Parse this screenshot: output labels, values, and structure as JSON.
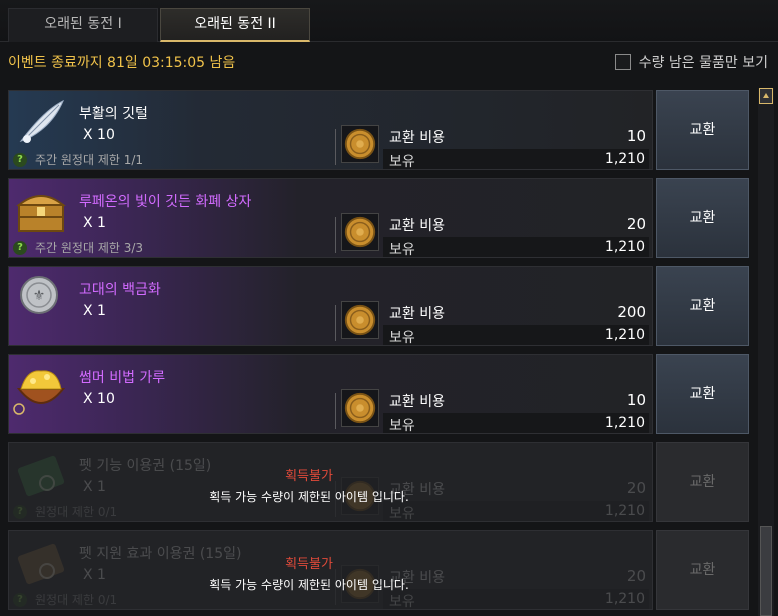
{
  "tabs": [
    {
      "label": "오래된 동전 I"
    },
    {
      "label": "오래된 동전 II"
    }
  ],
  "event_text": "이벤트 종료까지 81일 03:15:05 남음",
  "filter": {
    "label": "수량 남은 물품만 보기",
    "checked": false
  },
  "items": [
    {
      "name": "부활의 깃털",
      "qty": "X 10",
      "limit": "주간 원정대 제한 1/1",
      "cost_label": "교환 비용",
      "cost": "10",
      "own_label": "보유",
      "own": "1,210",
      "button": "교환",
      "icon": "feather-icon"
    },
    {
      "name": "루페온의 빛이 깃든 화폐 상자",
      "qty": "X 1",
      "limit": "주간 원정대 제한 3/3",
      "cost_label": "교환 비용",
      "cost": "20",
      "own_label": "보유",
      "own": "1,210",
      "button": "교환",
      "icon": "treasure-chest-icon"
    },
    {
      "name": "고대의 백금화",
      "qty": "X 1",
      "limit": "",
      "cost_label": "교환 비용",
      "cost": "200",
      "own_label": "보유",
      "own": "1,210",
      "button": "교환",
      "icon": "platinum-coin-icon"
    },
    {
      "name": "썸머 비법 가루",
      "qty": "X 10",
      "limit": "",
      "cost_label": "교환 비용",
      "cost": "10",
      "own_label": "보유",
      "own": "1,210",
      "button": "교환",
      "icon": "powder-bowl-icon"
    },
    {
      "name": "펫 기능 이용권 (15일)",
      "qty": "X 1",
      "limit": "원정대 제한 0/1",
      "cost_label": "교환 비용",
      "cost": "20",
      "own_label": "보유",
      "own": "1,210",
      "button": "교환",
      "icon": "ticket-icon",
      "unavailable_title": "획득불가",
      "unavailable_desc": "획득 가능 수량이 제한된 아이템 입니다."
    },
    {
      "name": "펫 지원 효과 이용권 (15일)",
      "qty": "X 1",
      "limit": "원정대 제한 0/1",
      "cost_label": "교환 비용",
      "cost": "20",
      "own_label": "보유",
      "own": "1,210",
      "button": "교환",
      "icon": "ticket-icon",
      "unavailable_title": "획득불가",
      "unavailable_desc": "획득 가능 수량이 제한된 아이템 입니다."
    }
  ],
  "colors": {
    "accent": "#d9b86a",
    "event_text": "#f0c24a",
    "rare_name": "#d26bff",
    "unavailable": "#e04a3a"
  }
}
